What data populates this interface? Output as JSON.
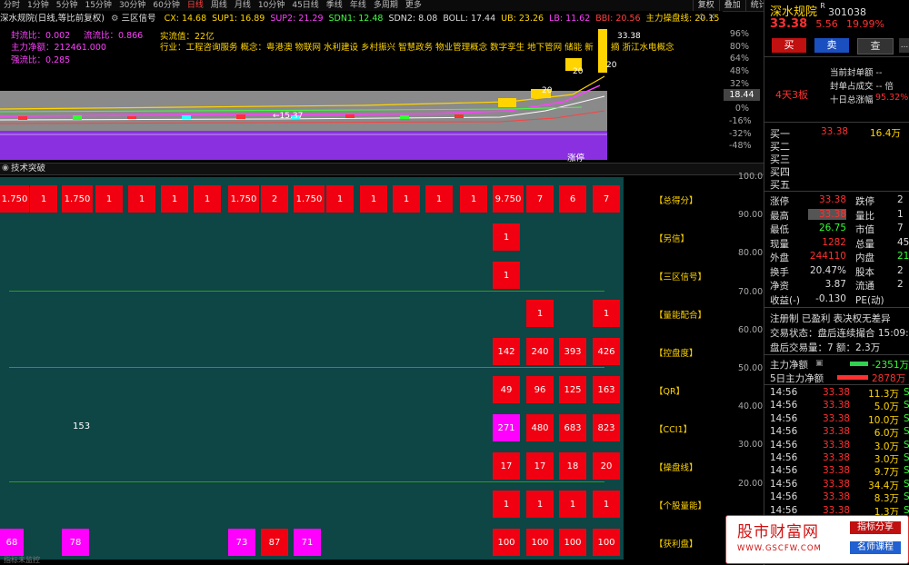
{
  "period_tabs": [
    "分时",
    "1分钟",
    "5分钟",
    "15分钟",
    "30分钟",
    "60分钟",
    "日线",
    "周线",
    "月线",
    "10分钟",
    "45日线",
    "季线",
    "年线",
    "多周期",
    "更多"
  ],
  "active_period": "日线",
  "tool_tabs": [
    "复权",
    "叠加",
    "统计",
    "画线",
    "F10",
    "标记",
    "+自选",
    "返回"
  ],
  "chart": {
    "title": "深水规院(日线,等比前复权)",
    "indicator_name": "三区信号",
    "params": [
      {
        "label": "CX: 14.68",
        "color": "#ffd400"
      },
      {
        "label": "SUP1: 16.89",
        "color": "#ffd400"
      },
      {
        "label": "SUP2: 21.29",
        "color": "#ff40ff"
      },
      {
        "label": "SDN1: 12.48",
        "color": "#40ff40"
      },
      {
        "label": "SDN2: 8.08",
        "color": "#dddddd"
      },
      {
        "label": "BOLL: 17.44",
        "color": "#dddddd"
      },
      {
        "label": "UB: 23.26",
        "color": "#ffd400"
      },
      {
        "label": "LB: 11.62",
        "color": "#ff40ff"
      },
      {
        "label": "BBI: 20.56",
        "color": "#ff4040"
      },
      {
        "label": "主力操盘线: 20.15",
        "color": "#ffd400"
      }
    ],
    "seal_ratio": "封流比：0.002",
    "float_ratio": "流流比：0.866",
    "capital_flow": "主力净额：212461.000",
    "strength_ratio": "强流比：0.285",
    "real_value": "实流值：22亿",
    "industry": "行业：工程咨询服务  概念：粤港澳 物联网 水利建设 乡村振兴 智慧政务 物业管理概念 数字孪生 地下管网 储能 新",
    "concept_tail": "摘 浙江水电概念",
    "price_tag": "18.44",
    "y_ticks": [
      "96%",
      "80%",
      "64%",
      "48%",
      "32%",
      "16%",
      "0%",
      "-16%",
      "-32%",
      "-48%"
    ],
    "annot_high": "33.38",
    "annot_low": "←15.37",
    "badge_20a": "20",
    "badge_20b": "20",
    "badge_20c": "20",
    "zhangting": "涨停"
  },
  "lower_panel": {
    "title": "技术突破",
    "row_labels": [
      "【总得分】",
      "【另信】",
      "【三区信号】",
      "【量能配合】",
      "【控盘度】",
      "【QR】",
      "【CCI1】",
      "【操盘线】",
      "【个股量能】",
      "【获利盘】"
    ],
    "y_ticks": [
      "100.0",
      "90.00",
      "80.00",
      "70.00",
      "60.00",
      "50.00",
      "40.00",
      "30.00",
      "20.00",
      "10.00"
    ],
    "row0": [
      "1.750",
      "1",
      "1.750",
      "1",
      "1",
      "1",
      "1",
      "1.750",
      "2",
      "1.750",
      "1",
      "1",
      "1",
      "1",
      "1",
      "9.750",
      "7",
      "6",
      "7"
    ],
    "signal_rows": [
      "1",
      "1"
    ],
    "row3": [
      "1",
      "1"
    ],
    "row4": [
      "142",
      "240",
      "393",
      "426"
    ],
    "row5": [
      "49",
      "96",
      "125",
      "163"
    ],
    "cci_left": "153",
    "row6": [
      "271",
      "480",
      "683",
      "823"
    ],
    "row7": [
      "17",
      "17",
      "18",
      "20"
    ],
    "row8": [
      "1",
      "1",
      "1",
      "1"
    ],
    "row9": [
      "68",
      "78",
      "73",
      "87",
      "71",
      "100",
      "100",
      "100",
      "100"
    ],
    "bottom_hint": "指标未监控"
  },
  "quote": {
    "name": "深水规院",
    "code": "301038",
    "flag": "R",
    "price": "33.38",
    "change": "5.56",
    "pct": "19.99%",
    "buy_btn": "买",
    "sell_btn": "卖",
    "check_btn": "查",
    "extra_btn": "...",
    "board": "4天3板",
    "seal_line1": "当前封单额  --",
    "seal_line2": "封单占成交  --  倍",
    "ten_day_label": "十日总涨幅",
    "ten_day_value": "95.32%",
    "bid_labels": [
      "买一",
      "买二",
      "买三",
      "买四",
      "买五"
    ],
    "bid1_price": "33.38",
    "bid1_vol": "16.4万",
    "stats": [
      {
        "k1": "涨停",
        "v1": "33.38",
        "k2": "跌停",
        "v2": "2"
      },
      {
        "k1": "最高",
        "v1": "33.38",
        "k2": "量比",
        "v2": "1"
      },
      {
        "k1": "最低",
        "v1": "26.75",
        "k2": "市值",
        "v2": "7"
      },
      {
        "k1": "现量",
        "v1": "1282",
        "k2": "总量",
        "v2": "45"
      },
      {
        "k1": "外盘",
        "v1": "244110",
        "k2": "内盘",
        "v2": "21"
      },
      {
        "k1": "换手",
        "v1": "20.47%",
        "k2": "股本",
        "v2": "2"
      },
      {
        "k1": "净资",
        "v1": "3.87",
        "k2": "流通",
        "v2": "2"
      },
      {
        "k1": "收益(-)",
        "v1": "-0.130",
        "k2": "PE(动)",
        "v2": ""
      }
    ],
    "tags_line": "注册制  已盈利  表决权无差异",
    "trade_status": "交易状态：盘后连续撮合 15:09:",
    "after_hours": "盘后交易量：7  额：2.3万",
    "main_net_label": "主力净额",
    "main_net_value": "-2351万",
    "five_day_label": "5日主力净额",
    "five_day_value": "2878万",
    "ticks": [
      {
        "time": "14:56",
        "price": "33.38",
        "vol": "11.3万",
        "bs": "S"
      },
      {
        "time": "14:56",
        "price": "33.38",
        "vol": "5.0万",
        "bs": "S"
      },
      {
        "time": "14:56",
        "price": "33.38",
        "vol": "10.0万",
        "bs": "S"
      },
      {
        "time": "14:56",
        "price": "33.38",
        "vol": "6.0万",
        "bs": "S"
      },
      {
        "time": "14:56",
        "price": "33.38",
        "vol": "3.0万",
        "bs": "S"
      },
      {
        "time": "14:56",
        "price": "33.38",
        "vol": "3.0万",
        "bs": "S"
      },
      {
        "time": "14:56",
        "price": "33.38",
        "vol": "9.7万",
        "bs": "S"
      },
      {
        "time": "14:56",
        "price": "33.38",
        "vol": "34.4万",
        "bs": "S"
      },
      {
        "time": "14:56",
        "price": "33.38",
        "vol": "8.3万",
        "bs": "S"
      },
      {
        "time": "14:56",
        "price": "33.38",
        "vol": "1.3万",
        "bs": "S"
      }
    ]
  },
  "watermark": {
    "title": "股市财富网",
    "url": "WWW.GSCFW.COM",
    "tag1": "指标分享",
    "tag2": "名师课程"
  },
  "colors": {
    "up": "#ff3030",
    "down": "#30ff30",
    "label": "#ffd400",
    "cell_red": "#f00010",
    "cell_magenta": "#ff00ff",
    "panel_bg": "#0e4545"
  }
}
